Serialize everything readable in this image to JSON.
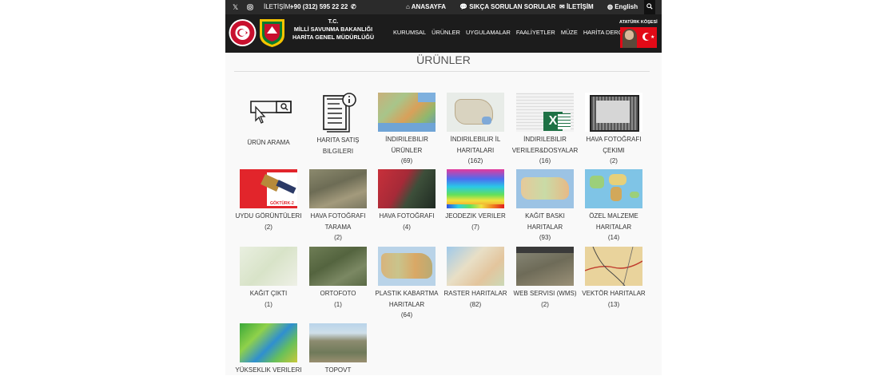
{
  "topbar": {
    "contact_label": "İLETİŞİM:",
    "phone": "+90 (312) 595 22 22",
    "home": "ANASAYFA",
    "faq": "SIKÇA SORULAN SORULAR",
    "contact": "İLETİŞİM",
    "lang": "English"
  },
  "org": {
    "line1": "T.C.",
    "line2": "MİLLİ SAVUNMA BAKANLIĞI",
    "line3": "HARİTA GENEL MÜDÜRLÜĞÜ"
  },
  "nav": [
    "KURUMSAL",
    "ÜRÜNLER",
    "UYGULAMALAR",
    "FAALİYETLER",
    "MÜZE",
    "HARİTA DERGİSİ"
  ],
  "ataturk_label": "ATATÜRK KÖŞESİ",
  "page_title": "ÜRÜNLER",
  "tiles": [
    {
      "name": "Ürün Arama",
      "count": ""
    },
    {
      "name": "Harita Satış Bilgileri",
      "count": ""
    },
    {
      "name": "İndirilebilir Ürünler",
      "count": "(69)"
    },
    {
      "name": "İndirilebilir İl Haritaları",
      "count": "(162)"
    },
    {
      "name": "İndirilebilir Veriler&Dosyalar",
      "count": "(16)"
    },
    {
      "name": "Hava Fotoğrafı Çekimi",
      "count": "(2)"
    },
    {
      "name": "Uydu Görüntüleri",
      "count": "(2)",
      "caption": "GÖKTÜRK-2"
    },
    {
      "name": "Hava Fotoğrafı Tarama",
      "count": "(2)"
    },
    {
      "name": "Hava Fotoğrafı",
      "count": "(4)"
    },
    {
      "name": "Jeodezik Veriler",
      "count": "(7)"
    },
    {
      "name": "Kağıt Baskı Haritalar",
      "count": "(93)"
    },
    {
      "name": "Özel Malzeme Haritalar",
      "count": "(14)"
    },
    {
      "name": "Kağıt Çıktı",
      "count": "(1)"
    },
    {
      "name": "Ortofoto",
      "count": "(1)"
    },
    {
      "name": "Plastik Kabartma Haritalar",
      "count": "(64)"
    },
    {
      "name": "Raster Haritalar",
      "count": "(82)"
    },
    {
      "name": "Web Servisi (WMS)",
      "count": "(2)"
    },
    {
      "name": "Vektör Haritalar",
      "count": "(13)"
    },
    {
      "name": "Yükseklik Verileri",
      "count": ""
    },
    {
      "name": "Topovt",
      "count": ""
    }
  ]
}
